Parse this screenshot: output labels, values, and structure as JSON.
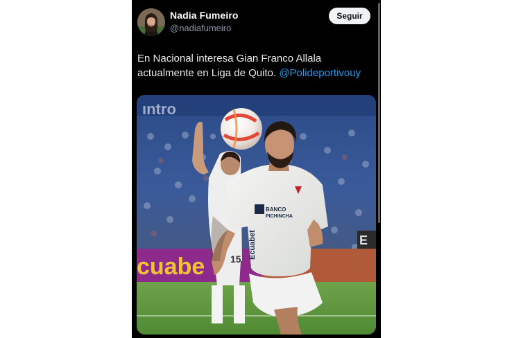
{
  "tweet": {
    "author": {
      "display_name": "Nadia Fumeiro",
      "handle": "@nadiafumeiro"
    },
    "follow_label": "Seguir",
    "text_before_mention": "En Nacional interesa Gian Franco Allala actualmente en Liga de Quito. ",
    "mention": "@Polideportivouy",
    "image": {
      "subject": "football-player-photo",
      "signage_left": "ıntro",
      "ad_board": "cuabe",
      "corner_sign": "E",
      "sponsor_text": "BANCO",
      "sponsor_text_2": "PICHINCHA",
      "shirt_sleeve": "Ecuabet",
      "player_number": "15"
    }
  },
  "colors": {
    "background": "#000000",
    "text": "#e7e9ea",
    "secondary_text": "#8b98a5",
    "mention": "#1d9bf0",
    "button_bg": "#eff3f4"
  },
  "icons": [
    "avatar-photo"
  ]
}
